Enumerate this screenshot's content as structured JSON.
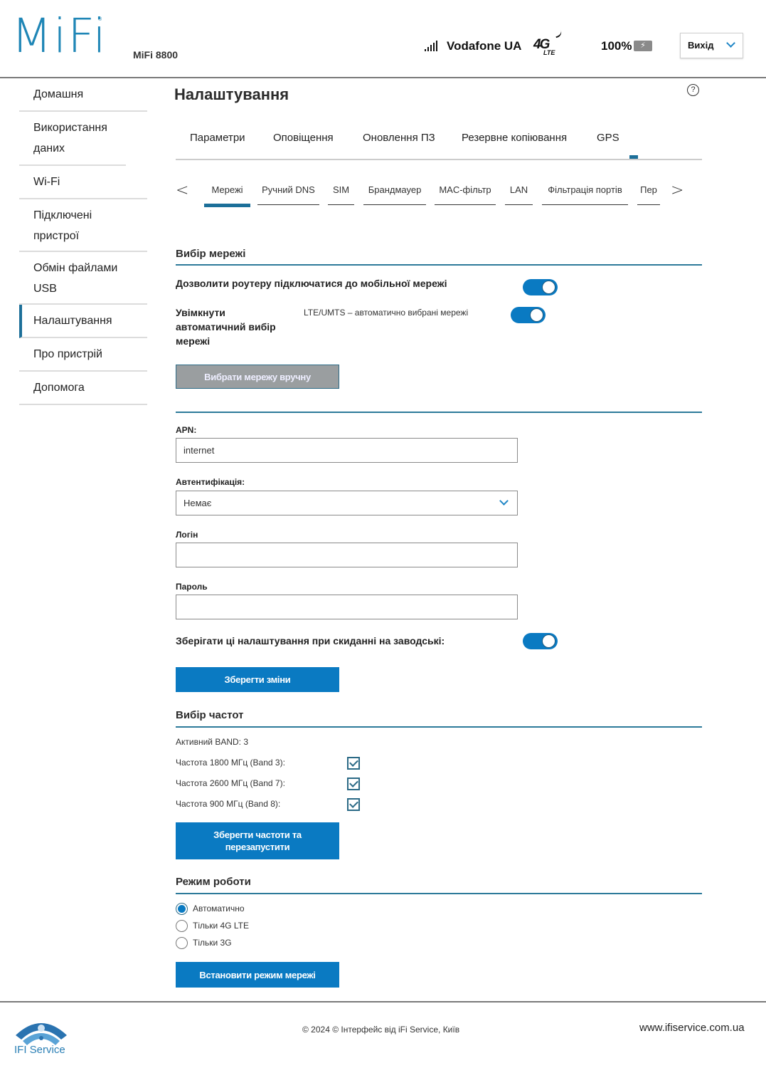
{
  "header": {
    "logo": "MiFi",
    "model": "MiFi 8800",
    "carrier": "Vodafone UA",
    "network_type": "4G",
    "network_sub": "LTE",
    "battery": "100%",
    "logout_label": "Вихід"
  },
  "sidebar": {
    "items": [
      {
        "label": "Домашня"
      },
      {
        "label": "Використання даних"
      },
      {
        "label": "Wi-Fi"
      },
      {
        "label": "Підключені пристрої"
      },
      {
        "label": "Обмін файлами USB"
      },
      {
        "label": "Налаштування",
        "active": true
      },
      {
        "label": "Про пристрій"
      },
      {
        "label": "Допомога"
      }
    ]
  },
  "main": {
    "title": "Налаштування",
    "help": "?",
    "tabs": [
      {
        "label": "Параметри"
      },
      {
        "label": "Оповіщення"
      },
      {
        "label": "Оновлення ПЗ"
      },
      {
        "label": "Резервне копіювання"
      },
      {
        "label": "GPS"
      }
    ],
    "subtabs": {
      "prev": "<",
      "next": ">",
      "items": [
        {
          "label": "Мережі",
          "active": true
        },
        {
          "label": "Ручний DNS"
        },
        {
          "label": "SIM"
        },
        {
          "label": "Брандмауер"
        },
        {
          "label": "MAC-фільтр"
        },
        {
          "label": "LAN"
        },
        {
          "label": "Фільтрація портів"
        },
        {
          "label": "Пер"
        }
      ]
    },
    "network_select": {
      "title": "Вибір мережі",
      "allow_label": "Дозволити роутеру підключатися до мобільної мережі",
      "allow_on": true,
      "auto_label": "Увімкнути автоматичний вибір мережі",
      "auto_note": "LTE/UMTS – автоматично вибрані мережі",
      "auto_on": true,
      "manual_button": "Вибрати мережу вручну"
    },
    "apn": {
      "apn_label": "APN:",
      "apn_value": "internet",
      "auth_label": "Автентифікація:",
      "auth_value": "Немає",
      "login_label": "Логін",
      "login_value": "",
      "password_label": "Пароль",
      "password_value": "",
      "keep_label": "Зберігати ці налаштування при скиданні на заводські:",
      "keep_on": true,
      "save_button": "Зберегти зміни"
    },
    "bands": {
      "title": "Вибір частот",
      "active": "Активний BAND: 3",
      "items": [
        {
          "label": "Частота 1800 МГц (Band 3):",
          "checked": true
        },
        {
          "label": "Частота 2600 МГц (Band 7):",
          "checked": true
        },
        {
          "label": "Частота 900 МГц (Band 8):",
          "checked": true
        }
      ],
      "save_button": "Зберегти частоти та перезапустити"
    },
    "mode": {
      "title": "Режим роботи",
      "options": [
        {
          "label": "Автоматично",
          "checked": true
        },
        {
          "label": "Тільки 4G LTE",
          "checked": false
        },
        {
          "label": "Тільки 3G",
          "checked": false
        }
      ],
      "set_button": "Встановити режим мережі"
    }
  },
  "footer": {
    "logo_text": "IFI Service",
    "copyright": "© 2024 © Інтерфейс від iFi Service, Київ",
    "url": "www.ifiservice.com.ua"
  },
  "colors": {
    "accent": "#0a7ac2",
    "brand": "#1f86b6",
    "active_marker": "#1c6f99"
  }
}
